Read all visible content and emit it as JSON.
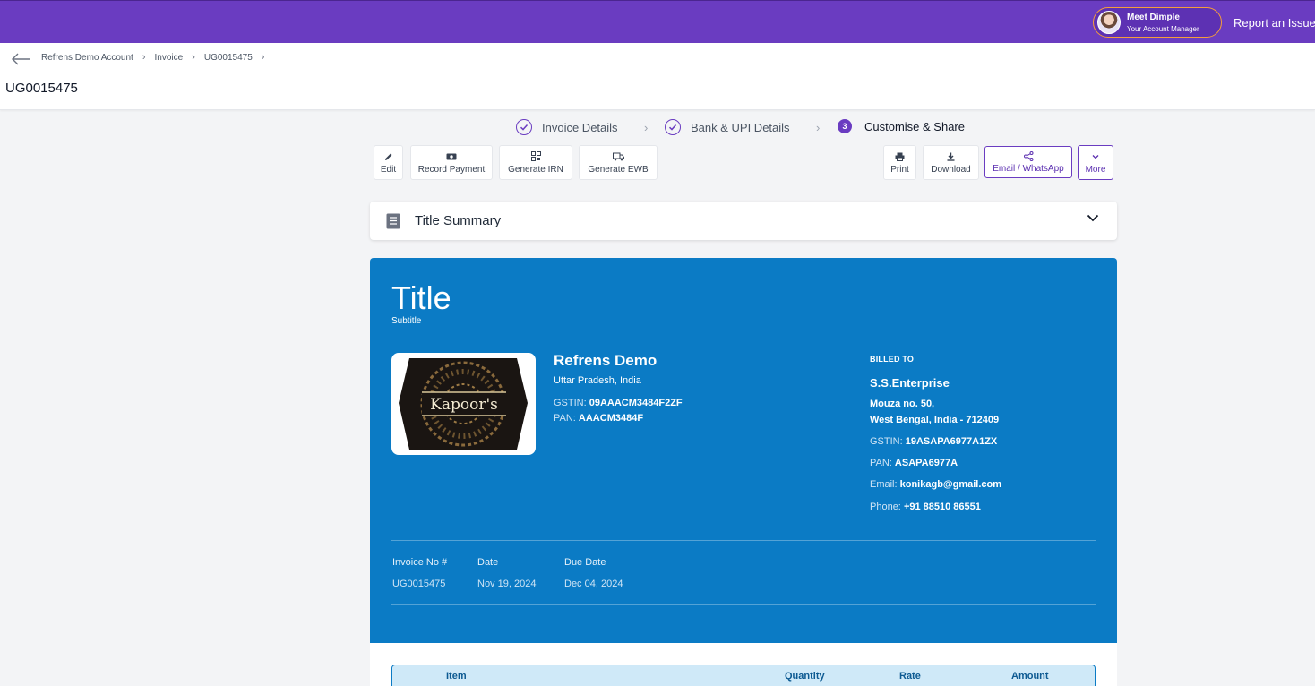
{
  "topbar": {
    "manager_name": "Meet Dimple",
    "manager_role": "Your Account Manager",
    "report_label": "Report an Issue"
  },
  "breadcrumb": [
    "Refrens Demo Account",
    "Invoice",
    "UG0015475"
  ],
  "page_title": "UG0015475",
  "stepper": [
    {
      "label": "Invoice Details",
      "state": "done"
    },
    {
      "label": "Bank & UPI Details",
      "state": "done"
    },
    {
      "label": "Customise & Share",
      "state": "active",
      "number": "3"
    }
  ],
  "toolbar": {
    "edit": "Edit",
    "record_payment": "Record Payment",
    "generate_irn": "Generate IRN",
    "generate_ewb": "Generate EWB",
    "print": "Print",
    "download": "Download",
    "email_whatsapp": "Email / WhatsApp",
    "more": "More"
  },
  "summary": {
    "label": "Title Summary"
  },
  "invoice": {
    "title": "Title",
    "subtitle": "Subtitle",
    "logo_text": "Kapoor's",
    "seller": {
      "name": "Refrens Demo",
      "address": "Uttar Pradesh, India",
      "gstin_label": "GSTIN:",
      "gstin": "09AAACM3484F2ZF",
      "pan_label": "PAN:",
      "pan": "AAACM3484F"
    },
    "buyer": {
      "heading": "BILLED TO",
      "name": "S.S.Enterprise",
      "address_line1": "Mouza no. 50,",
      "address_line2": "West Bengal, India - 712409",
      "gstin_label": "GSTIN:",
      "gstin": "19ASAPA6977A1ZX",
      "pan_label": "PAN:",
      "pan": "ASAPA6977A",
      "email_label": "Email:",
      "email": "konikagb@gmail.com",
      "phone_label": "Phone:",
      "phone": "+91 88510 86551"
    },
    "meta": {
      "invoice_no_label": "Invoice No #",
      "invoice_no": "UG0015475",
      "date_label": "Date",
      "date": "Nov 19, 2024",
      "due_label": "Due Date",
      "due": "Dec 04, 2024"
    }
  },
  "items_table": {
    "columns": [
      "Item",
      "Quantity",
      "Rate",
      "Amount"
    ]
  },
  "colors": {
    "brand_purple": "#6a3cc1",
    "invoice_blue": "#0b7bc5",
    "manager_border": "#f59e3b"
  }
}
